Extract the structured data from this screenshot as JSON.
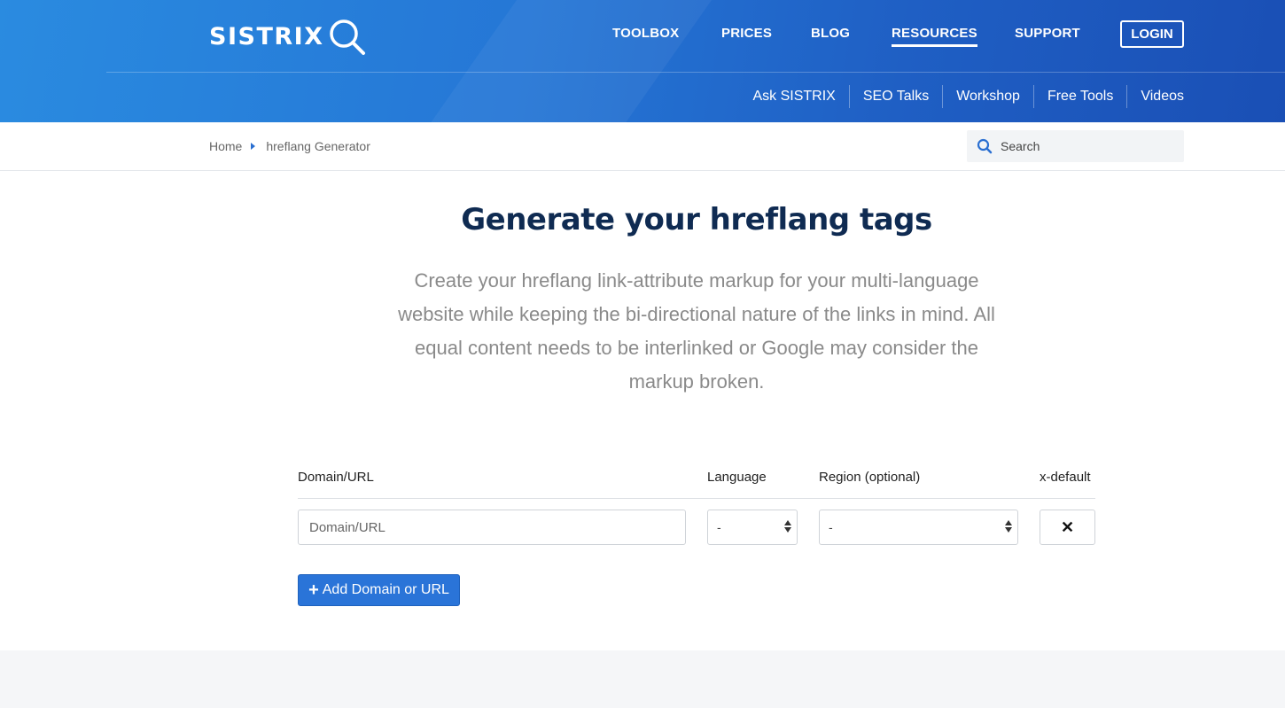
{
  "brand": {
    "logo_text": "SISTRIX"
  },
  "nav": {
    "items": [
      {
        "label": "TOOLBOX"
      },
      {
        "label": "PRICES"
      },
      {
        "label": "BLOG"
      },
      {
        "label": "RESOURCES",
        "active": true
      },
      {
        "label": "SUPPORT"
      }
    ],
    "login_label": "LOGIN"
  },
  "subnav": {
    "items": [
      {
        "label": "Ask SISTRIX"
      },
      {
        "label": "SEO Talks"
      },
      {
        "label": "Workshop"
      },
      {
        "label": "Free Tools"
      },
      {
        "label": "Videos"
      }
    ]
  },
  "breadcrumb": {
    "home": "Home",
    "current": "hreflang Generator"
  },
  "search": {
    "placeholder": "Search"
  },
  "main": {
    "title": "Generate your hreflang tags",
    "intro": "Create your hreflang link-attribute markup for your multi-language website while keeping the bi-directional nature of the links in mind. All equal content needs to be interlinked or Google may consider the markup broken."
  },
  "form": {
    "headers": {
      "domain": "Domain/URL",
      "language": "Language",
      "region": "Region (optional)",
      "xdefault": "x-default"
    },
    "url_placeholder": "Domain/URL",
    "language_value": "-",
    "region_value": "-",
    "xdefault_glyph": "✕",
    "add_button_plus": "+",
    "add_button_label": "Add Domain or URL"
  },
  "colors": {
    "accent": "#2a74d8",
    "header_start": "#2a8be0",
    "header_end": "#1a4fb5",
    "title": "#0f2b52"
  }
}
